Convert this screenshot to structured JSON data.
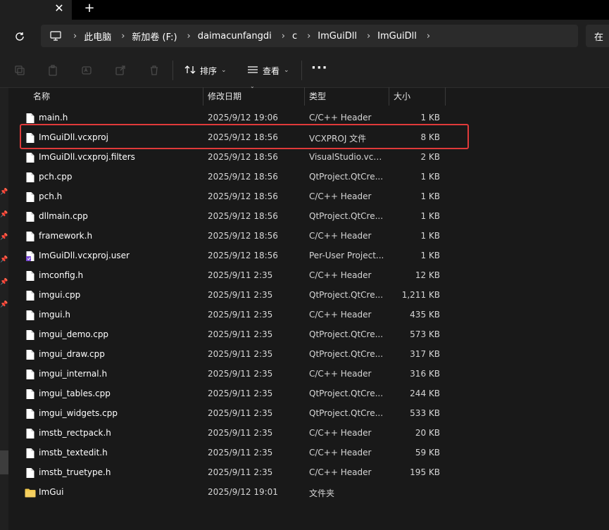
{
  "titlebar": {
    "close_glyph": "✕",
    "new_tab_glyph": "+"
  },
  "addressbar": {
    "items": [
      "此电脑",
      "新加卷 (F:)",
      "daimacunfangdi",
      "c",
      "ImGuiDll",
      "ImGuiDll"
    ],
    "search_partial": "在"
  },
  "toolbar": {
    "sort_label": "排序",
    "view_label": "查看",
    "more_glyph": "···"
  },
  "columns": {
    "name": "名称",
    "date": "修改日期",
    "type": "类型",
    "size": "大小"
  },
  "files": [
    {
      "name": "main.h",
      "date": "2025/9/12 19:06",
      "type": "C/C++ Header",
      "size": "1 KB",
      "icon": "file-icon"
    },
    {
      "name": "ImGuiDll.vcxproj",
      "date": "2025/9/12 18:56",
      "type": "VCXPROJ 文件",
      "size": "8 KB",
      "icon": "file-icon"
    },
    {
      "name": "ImGuiDll.vcxproj.filters",
      "date": "2025/9/12 18:56",
      "type": "VisualStudio.vcx...",
      "size": "2 KB",
      "icon": "file-icon"
    },
    {
      "name": "pch.cpp",
      "date": "2025/9/12 18:56",
      "type": "QtProject.QtCre...",
      "size": "1 KB",
      "icon": "file-icon"
    },
    {
      "name": "pch.h",
      "date": "2025/9/12 18:56",
      "type": "C/C++ Header",
      "size": "1 KB",
      "icon": "file-icon"
    },
    {
      "name": "dllmain.cpp",
      "date": "2025/9/12 18:56",
      "type": "QtProject.QtCre...",
      "size": "1 KB",
      "icon": "file-icon"
    },
    {
      "name": "framework.h",
      "date": "2025/9/12 18:56",
      "type": "C/C++ Header",
      "size": "1 KB",
      "icon": "file-icon"
    },
    {
      "name": "ImGuiDll.vcxproj.user",
      "date": "2025/9/12 18:56",
      "type": "Per-User Project...",
      "size": "1 KB",
      "icon": "user-file-icon"
    },
    {
      "name": "imconfig.h",
      "date": "2025/9/11 2:35",
      "type": "C/C++ Header",
      "size": "12 KB",
      "icon": "file-icon"
    },
    {
      "name": "imgui.cpp",
      "date": "2025/9/11 2:35",
      "type": "QtProject.QtCre...",
      "size": "1,211 KB",
      "icon": "file-icon"
    },
    {
      "name": "imgui.h",
      "date": "2025/9/11 2:35",
      "type": "C/C++ Header",
      "size": "435 KB",
      "icon": "file-icon"
    },
    {
      "name": "imgui_demo.cpp",
      "date": "2025/9/11 2:35",
      "type": "QtProject.QtCre...",
      "size": "573 KB",
      "icon": "file-icon"
    },
    {
      "name": "imgui_draw.cpp",
      "date": "2025/9/11 2:35",
      "type": "QtProject.QtCre...",
      "size": "317 KB",
      "icon": "file-icon"
    },
    {
      "name": "imgui_internal.h",
      "date": "2025/9/11 2:35",
      "type": "C/C++ Header",
      "size": "316 KB",
      "icon": "file-icon"
    },
    {
      "name": "imgui_tables.cpp",
      "date": "2025/9/11 2:35",
      "type": "QtProject.QtCre...",
      "size": "244 KB",
      "icon": "file-icon"
    },
    {
      "name": "imgui_widgets.cpp",
      "date": "2025/9/11 2:35",
      "type": "QtProject.QtCre...",
      "size": "533 KB",
      "icon": "file-icon"
    },
    {
      "name": "imstb_rectpack.h",
      "date": "2025/9/11 2:35",
      "type": "C/C++ Header",
      "size": "20 KB",
      "icon": "file-icon"
    },
    {
      "name": "imstb_textedit.h",
      "date": "2025/9/11 2:35",
      "type": "C/C++ Header",
      "size": "59 KB",
      "icon": "file-icon"
    },
    {
      "name": "imstb_truetype.h",
      "date": "2025/9/11 2:35",
      "type": "C/C++ Header",
      "size": "195 KB",
      "icon": "file-icon"
    },
    {
      "name": "ImGui",
      "date": "2025/9/12 19:01",
      "type": "文件夹",
      "size": "",
      "icon": "folder-icon"
    }
  ],
  "highlighted_file": "ImGuiDll.vcxproj",
  "colors": {
    "highlight_border": "#e03a3a",
    "folder": "#f2c94c",
    "background": "#191919"
  }
}
